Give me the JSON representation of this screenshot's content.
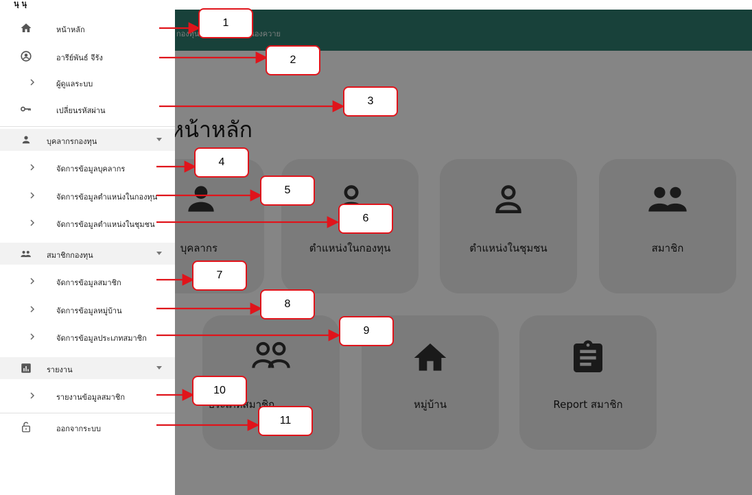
{
  "top_strip_text": "นุ นุ",
  "breadcrumb": {
    "part1": "กองทุน",
    "part2": "ตำบลหนองควาย"
  },
  "dashboard": {
    "title": "หน้าหลัก",
    "cards": [
      {
        "label": "บุคลากร",
        "icon": "person-icon"
      },
      {
        "label": "ตำแหน่งในกองทุน",
        "icon": "person-outline-icon"
      },
      {
        "label": "ตำแหน่งในชุมชน",
        "icon": "person-outline-icon"
      },
      {
        "label": "สมาชิก",
        "icon": "people-icon"
      },
      {
        "label": "ประเภทสมาชิก",
        "icon": "people-outline-icon"
      },
      {
        "label": "หมู่บ้าน",
        "icon": "home-icon"
      },
      {
        "label": "Report สมาชิก",
        "icon": "clipboard-icon"
      }
    ]
  },
  "drawer": {
    "home": {
      "label": "หน้าหลัก",
      "icon": "home-icon"
    },
    "user": {
      "label": "อารีย์พันธ์ จีรัง",
      "icon": "account-circle-icon"
    },
    "admin": {
      "label": "ผู้ดูแลระบบ",
      "icon": "chevron-right-icon"
    },
    "change_password": {
      "label": "เปลี่ยนรหัสผ่าน",
      "icon": "key-icon"
    },
    "personnel_section": {
      "label": "บุคลากรกองทุน",
      "icon": "person-icon",
      "items": [
        "จัดการข้อมูลบุคลากร",
        "จัดการข้อมูลตำแหน่งในกองทุน",
        "จัดการข้อมูลตำแหน่งในชุมชน"
      ]
    },
    "members_section": {
      "label": "สมาชิกกองทุน",
      "icon": "group-icon",
      "items": [
        "จัดการข้อมูลสมาชิก",
        "จัดการข้อมูลหมู่บ้าน",
        "จัดการข้อมูลประเภทสมาชิก"
      ]
    },
    "report_section": {
      "label": "รายงาน",
      "icon": "bar-chart-icon",
      "items": [
        "รายงานข้อมูลสมาชิก"
      ]
    },
    "logout": {
      "label": "ออกจากระบบ",
      "icon": "lock-open-icon"
    }
  },
  "annotations": {
    "arrow_color": "#e0141b",
    "badges": [
      "1",
      "2",
      "3",
      "4",
      "5",
      "6",
      "7",
      "8",
      "9",
      "10",
      "11"
    ]
  },
  "colors": {
    "appbar": "#2f7d6f",
    "badge_border": "#e0141b"
  }
}
